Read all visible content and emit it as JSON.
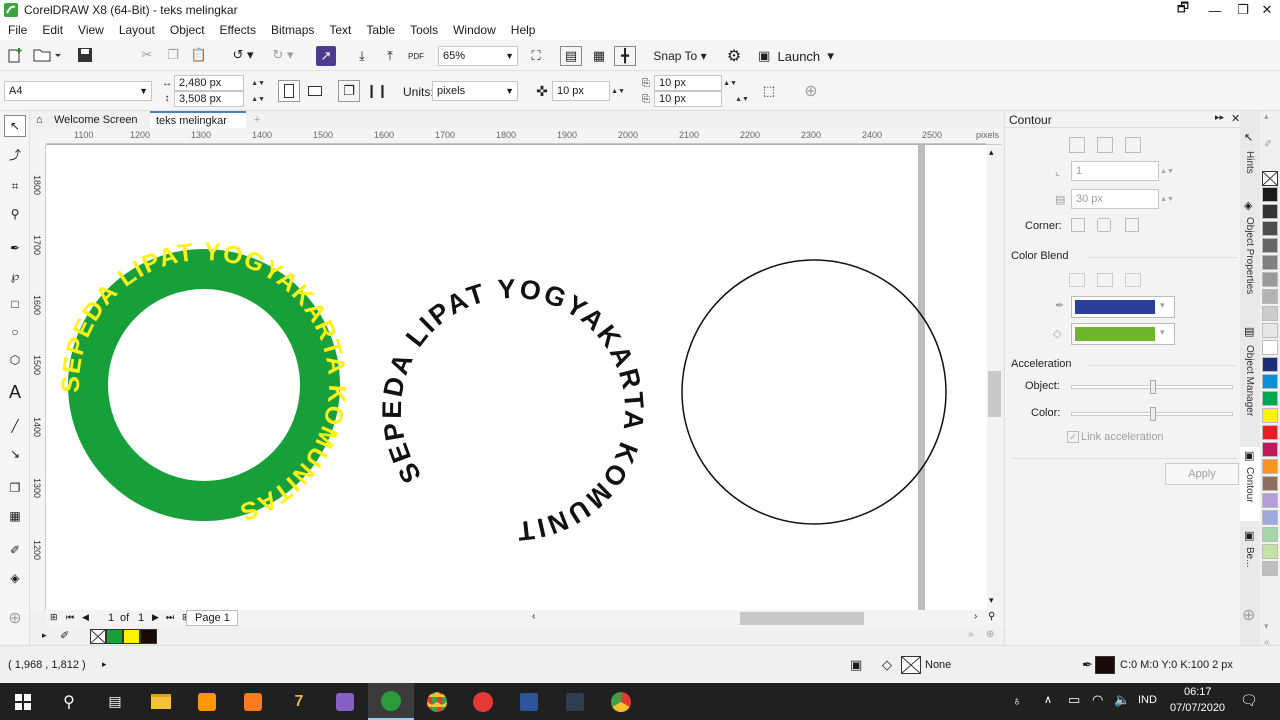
{
  "window": {
    "title": "CorelDRAW X8 (64-Bit) - teks melingkar"
  },
  "menu": [
    "File",
    "Edit",
    "View",
    "Layout",
    "Object",
    "Effects",
    "Bitmaps",
    "Text",
    "Table",
    "Tools",
    "Window",
    "Help"
  ],
  "toolbar": {
    "zoom": "65%",
    "snap_to": "Snap To",
    "launch": "Launch"
  },
  "propbar": {
    "page_size": "A4",
    "width": "2,480 px",
    "height": "3,508 px",
    "units_label": "Units:",
    "units": "pixels",
    "nudge": "10 px",
    "dup_x": "10 px",
    "dup_y": "10 px"
  },
  "tabs": {
    "welcome": "Welcome Screen",
    "doc": "teks melingkar"
  },
  "ruler": {
    "h_ticks": [
      "1100",
      "1200",
      "1300",
      "1400",
      "1500",
      "1600",
      "1700",
      "1800",
      "1900",
      "2000",
      "2100",
      "2200",
      "2300",
      "2400",
      "2500"
    ],
    "unit": "pixels",
    "v_ticks": [
      "1800",
      "1700",
      "1600",
      "1500",
      "1400",
      "1300",
      "1200"
    ]
  },
  "canvas": {
    "circle_text": "SEPEDA LIPAT YOGYAKARTA KOMUNITAS",
    "ring_color": "#17a03a",
    "ring_text_color": "#ffef1a"
  },
  "pagebar": {
    "current": "1",
    "of": "of",
    "total": "1",
    "page_tab": "Page 1"
  },
  "docker": {
    "title": "Contour",
    "steps": "1",
    "offset": "30 px",
    "corner_label": "Corner:",
    "color_blend_label": "Color Blend",
    "outline_color": "#2b3f9a",
    "fill_color": "#6cb52d",
    "acceleration_label": "Acceleration",
    "object_label": "Object:",
    "color_label": "Color:",
    "link_label": "Link acceleration",
    "apply": "Apply"
  },
  "docker_tabs": [
    "Hints",
    "Object Properties",
    "Object Manager",
    "Contour",
    "Be..."
  ],
  "palette_colors": [
    "#1a1a1a",
    "#333333",
    "#4d4d4d",
    "#666666",
    "#808080",
    "#999999",
    "#b3b3b3",
    "#cccccc",
    "#e6e6e6",
    "#ffffff",
    "#1d2e7d",
    "#0a8fd6",
    "#00a651",
    "#fff200",
    "#ed1c24",
    "#c2185b",
    "#f7941d",
    "#8d6e63",
    "#b39ddb",
    "#9fa8da",
    "#a5d6a7",
    "#c5e1a5",
    "#bdbdbd"
  ],
  "doc_palette": [
    "#17a03a",
    "#fff200",
    "#1a0a0a"
  ],
  "status": {
    "coords": "( 1,968 , 1,812 )",
    "fill": "None",
    "outline": "C:0 M:0 Y:0 K:100  2 px"
  },
  "taskbar": {
    "time": "06:17",
    "date": "07/07/2020",
    "lang": "IND"
  }
}
